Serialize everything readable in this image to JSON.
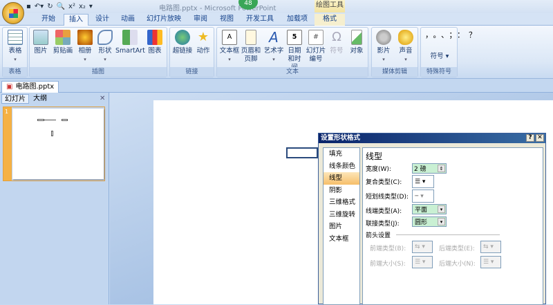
{
  "window": {
    "title": "电路图.pptx - Microsoft PowerPoint",
    "badge": "48",
    "context_group": "绘图工具"
  },
  "tabs": [
    "开始",
    "插入",
    "设计",
    "动画",
    "幻灯片放映",
    "审阅",
    "视图",
    "开发工具",
    "加载项",
    "格式"
  ],
  "ribbon": {
    "groups": [
      "表格",
      "插图",
      "链接",
      "文本",
      "媒体剪辑",
      "特殊符号"
    ],
    "buttons": {
      "table": "表格",
      "picture": "图片",
      "clipart": "剪贴画",
      "album": "相册",
      "shapes": "形状",
      "smartart": "SmartArt",
      "chart": "图表",
      "hyperlink": "超链接",
      "action": "动作",
      "textbox": "文本框",
      "header_footer": "页眉和页脚",
      "wordart": "艺术字",
      "datetime": "日期和时间",
      "slide_number": "幻灯片编号",
      "symbol": "符号",
      "object": "对象",
      "movie": "影片",
      "sound": "声音",
      "special_symbol": "符号"
    },
    "special_chars": "，。、；：？"
  },
  "document_tab": "电路图.pptx",
  "panel": {
    "tabs": [
      "幻灯片",
      "大纲"
    ],
    "slide_number": "1"
  },
  "dialog": {
    "title": "设置形状格式",
    "nav": [
      "填充",
      "线条颜色",
      "线型",
      "阴影",
      "三维格式",
      "三维旋转",
      "图片",
      "文本框"
    ],
    "selected": "线型",
    "heading": "线型",
    "width_label": "宽度(W):",
    "width_value": "2 磅",
    "compound_label": "复合类型(C):",
    "dash_label": "短划线类型(D):",
    "cap_label": "线端类型(A):",
    "cap_value": "平面",
    "join_label": "联接类型(J):",
    "join_value": "圆形",
    "arrow_section": "箭头设置",
    "begin_type": "前端类型(B):",
    "end_type": "后端类型(E):",
    "begin_size": "前端大小(S):",
    "end_size": "后端大小(N):"
  }
}
